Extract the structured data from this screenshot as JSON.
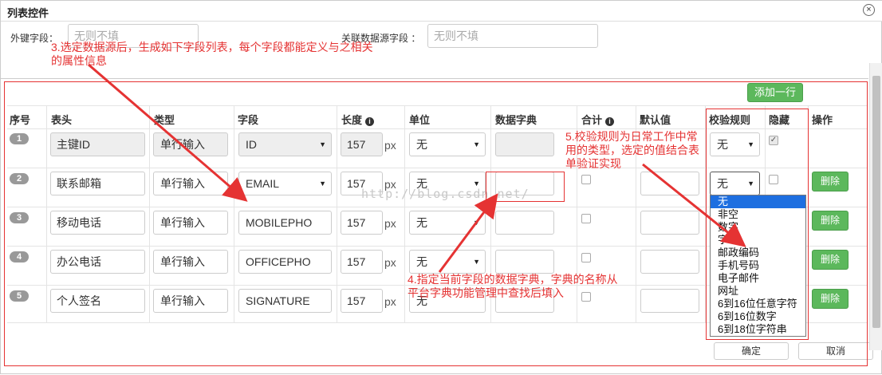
{
  "dialog": {
    "title": "列表控件",
    "close_icon": "close-icon",
    "fk_label": "外键字段：",
    "fk_placeholder": "无则不填",
    "rel_label": "关联数据源字段 ：",
    "rel_placeholder": "无则不填",
    "add_row_label": "添加一行",
    "confirm_label": "确定",
    "cancel_label": "取消"
  },
  "table": {
    "headers": [
      "序号",
      "表头",
      "类型",
      "字段",
      "长度",
      "单位",
      "数据字典",
      "合计",
      "默认值",
      "校验规则",
      "隐藏",
      "操作"
    ],
    "unit_text": "px",
    "delete_label": "删除",
    "rows": [
      {
        "num": "1",
        "header": "主键ID",
        "type": "单行输入",
        "field": "ID",
        "length": "157",
        "unit": "无",
        "validate": "无",
        "hidden": true
      },
      {
        "num": "2",
        "header": "联系邮箱",
        "type": "单行输入",
        "field": "EMAIL",
        "length": "157",
        "unit": "无",
        "validate": "无",
        "hidden": false
      },
      {
        "num": "3",
        "header": "移动电话",
        "type": "单行输入",
        "field": "MOBILEPHO",
        "length": "157",
        "unit": "无",
        "hidden": false
      },
      {
        "num": "4",
        "header": "办公电话",
        "type": "单行输入",
        "field": "OFFICEPHO",
        "length": "157",
        "unit": "无",
        "hidden": false
      },
      {
        "num": "5",
        "header": "个人签名",
        "type": "单行输入",
        "field": "SIGNATURE",
        "length": "157",
        "unit": "无",
        "hidden": false
      }
    ]
  },
  "validate_dropdown": {
    "options": [
      "无",
      "非空",
      "数字",
      "字母",
      "邮政编码",
      "手机号码",
      "电子邮件",
      "网址",
      "6到16位任意字符",
      "6到16位数字",
      "6到18位字符串"
    ],
    "selected": "无"
  },
  "annotations": {
    "a3": "3.选定数据源后，生成如下字段列表，每个字段都能定义与之相关的属性信息",
    "a4": "4.指定当前字段的数据字典，字典的名称从平台字典功能管理中查找后填入",
    "a5": "5.校验规则为日常工作中常用的类型，选定的值结合表单验证实现"
  },
  "watermark": "http://blog.csdn.net/",
  "colors": {
    "annotation": "#e53333",
    "button_green": "#5cb85c",
    "dropdown_highlight": "#1e6fe0"
  }
}
